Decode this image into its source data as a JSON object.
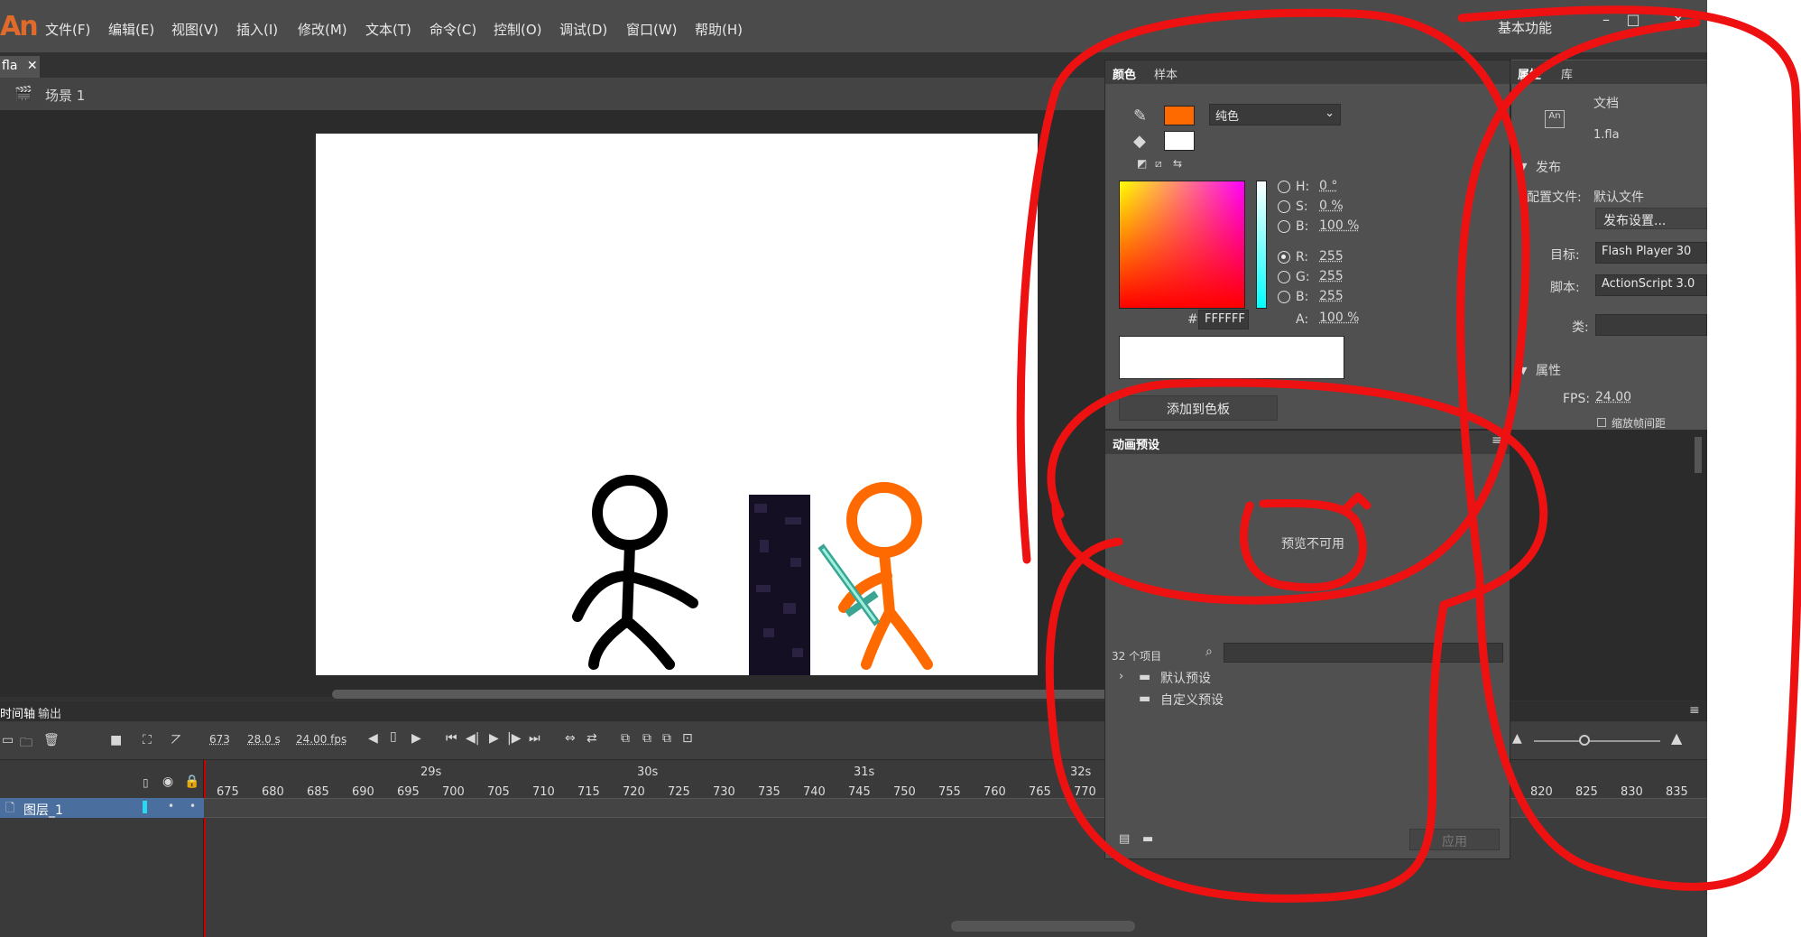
{
  "app": {
    "logo": "An",
    "workspace": "基本功能",
    "doc_tab": "fla",
    "scene": "场景 1"
  },
  "menu": [
    "文件(F)",
    "编辑(E)",
    "视图(V)",
    "插入(I)",
    "修改(M)",
    "文本(T)",
    "命令(C)",
    "控制(O)",
    "调试(D)",
    "窗口(W)",
    "帮助(H)"
  ],
  "color_panel": {
    "tabs": [
      "颜色",
      "样本"
    ],
    "stroke_color": "#ff6a00",
    "fill_color": "#ffffff",
    "fill_type": "纯色",
    "hsb": {
      "h_label": "H:",
      "h": "0 °",
      "s_label": "S:",
      "s": "0 %",
      "b_label": "B:",
      "b": "100 %"
    },
    "rgb": {
      "r_label": "R:",
      "r": "255",
      "g_label": "G:",
      "g": "255",
      "b_label": "B:",
      "b": "255",
      "a_label": "A:",
      "a": "100 %"
    },
    "hex_label": "#",
    "hex": "FFFFFF",
    "add_button": "添加到色板"
  },
  "anim_preset": {
    "title": "动画预设",
    "preview_text": "预览不可用",
    "count": "32 个项目",
    "folders": [
      "默认预设",
      "自定义预设"
    ],
    "apply_button": "应用"
  },
  "properties": {
    "tabs": [
      "属性",
      "库"
    ],
    "doc_type": "文档",
    "doc_name": "1.fla",
    "publish_section": "发布",
    "profile_label": "配置文件:",
    "profile_value": "默认文件",
    "publish_settings": "发布设置...",
    "target_label": "目标:",
    "target_value": "Flash Player 30",
    "script_label": "脚本:",
    "script_value": "ActionScript 3.0",
    "class_label": "类:",
    "props_section": "属性",
    "fps_label": "FPS:",
    "fps_value": "24.00",
    "scale_label": "缩放帧间距"
  },
  "timeline": {
    "tabs": [
      "时间轴",
      "输出"
    ],
    "current_frame": "673",
    "time": "28.0 s",
    "fps": "24.00 fps",
    "layer_name": "图层_1",
    "seconds": [
      {
        "label": "29s",
        "pos": 0.24
      },
      {
        "label": "30s",
        "pos": 0.48
      },
      {
        "label": "31s",
        "pos": 0.72
      },
      {
        "label": "32s",
        "pos": 0.96
      }
    ],
    "frame_ticks": [
      "675",
      "680",
      "685",
      "690",
      "695",
      "700",
      "705",
      "710",
      "715",
      "720",
      "725",
      "730",
      "735",
      "740",
      "745",
      "750",
      "755",
      "760",
      "765",
      "770"
    ],
    "frame_ticks_right": [
      "820",
      "825",
      "830",
      "835"
    ]
  }
}
